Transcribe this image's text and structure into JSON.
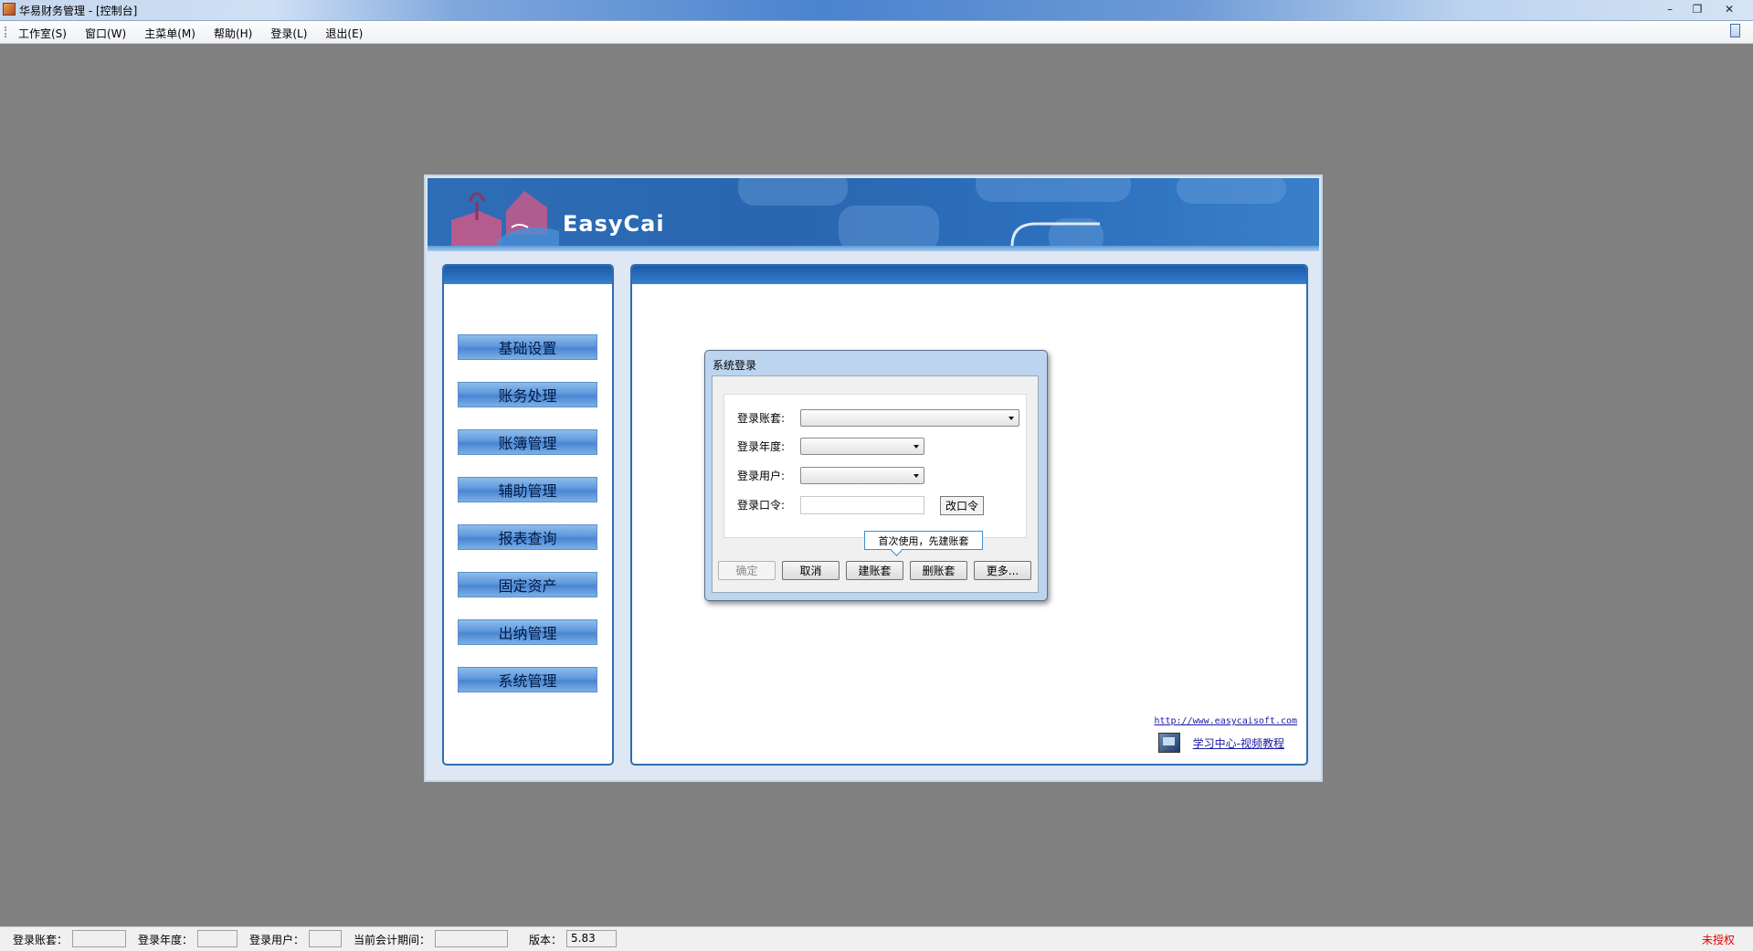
{
  "window": {
    "title": "华易财务管理 - [控制台]",
    "controls": {
      "minimize": "–",
      "restore": "❐",
      "close": "✕"
    }
  },
  "menu": {
    "items": [
      "工作室(S)",
      "窗口(W)",
      "主菜单(M)",
      "帮助(H)",
      "登录(L)",
      "退出(E)"
    ]
  },
  "console": {
    "brand": "EasyCai",
    "nav": [
      "基础设置",
      "账务处理",
      "账簿管理",
      "辅助管理",
      "报表查询",
      "固定资产",
      "出纳管理",
      "系统管理"
    ],
    "website": "http://www.easycaisoft.com",
    "study_link": "学习中心-视频教程"
  },
  "login_dialog": {
    "title": "系统登录",
    "fields": {
      "account_set_label": "登录账套:",
      "account_set_value": "",
      "year_label": "登录年度:",
      "year_value": "",
      "user_label": "登录用户:",
      "user_value": "",
      "password_label": "登录口令:",
      "password_value": ""
    },
    "change_password": "改口令",
    "tip": "首次使用，先建账套",
    "buttons": {
      "ok": "确定",
      "cancel": "取消",
      "create": "建账套",
      "delete": "删账套",
      "more": "更多..."
    }
  },
  "statusbar": {
    "account_set_label": "登录账套：",
    "account_set_value": "",
    "year_label": "登录年度：",
    "year_value": "",
    "user_label": "登录用户：",
    "user_value": "",
    "period_label": "当前会计期间：",
    "period_value": "",
    "version_label": "版本：",
    "version_value": "5.83",
    "license": "未授权"
  }
}
